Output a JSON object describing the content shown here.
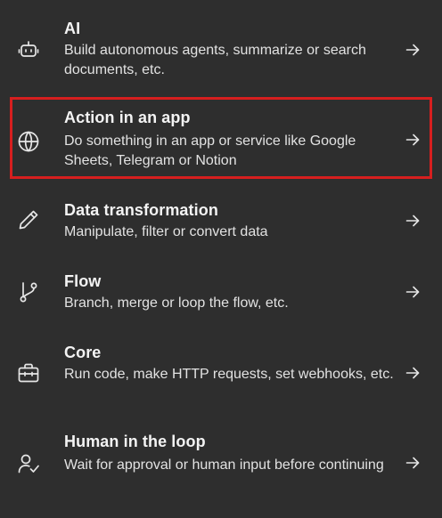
{
  "menu": {
    "items": [
      {
        "title": "AI",
        "description": "Build autonomous agents, summarize or search documents, etc.",
        "icon": "robot-icon"
      },
      {
        "title": "Action in an app",
        "description": "Do something in an app or service like Google Sheets, Telegram or Notion",
        "icon": "globe-icon",
        "highlighted": true
      },
      {
        "title": "Data transformation",
        "description": "Manipulate, filter or convert data",
        "icon": "pencil-icon"
      },
      {
        "title": "Flow",
        "description": "Branch, merge or loop the flow, etc.",
        "icon": "git-branch-icon"
      },
      {
        "title": "Core",
        "description": "Run code, make HTTP requests, set webhooks, etc.",
        "icon": "toolbox-icon"
      },
      {
        "title": "Human in the loop",
        "description": "Wait for approval or human input before continuing",
        "icon": "user-check-icon"
      }
    ],
    "arrow_icon": "arrow-right-icon",
    "highlight_color": "#d61f1f"
  }
}
